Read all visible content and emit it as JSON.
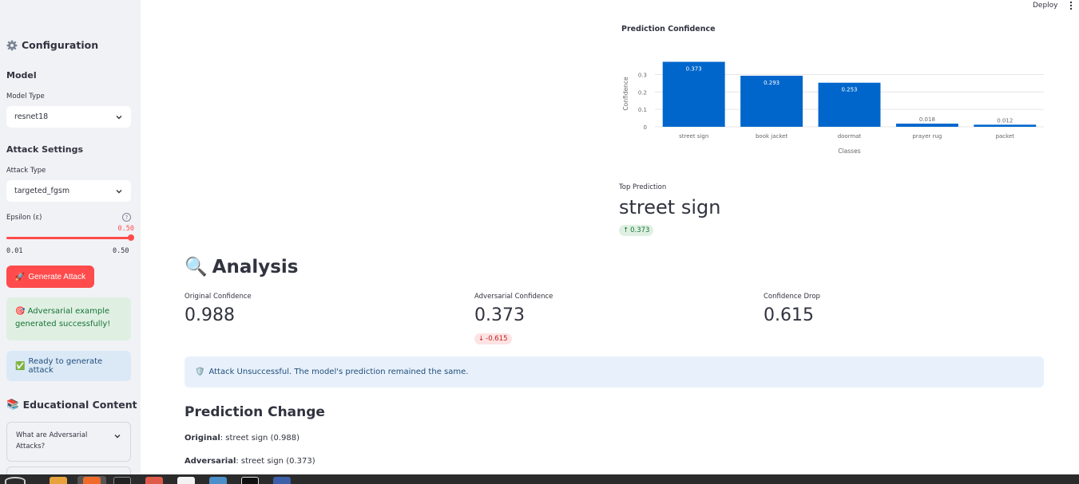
{
  "sidebar": {
    "title": "Configuration",
    "model_heading": "Model",
    "model_type_label": "Model Type",
    "model_type_value": "resnet18",
    "attack_heading": "Attack Settings",
    "attack_type_label": "Attack Type",
    "attack_type_value": "targeted_fgsm",
    "epsilon_label": "Epsilon (ε)",
    "epsilon_value": "0.50",
    "epsilon_min": "0.01",
    "epsilon_max": "0.50",
    "epsilon_fraction": 1.0,
    "generate_button": "Generate Attack",
    "success_message": "Adversarial example generated successfully!",
    "info_message": "Ready to generate attack",
    "edu_title": "Educational Content",
    "expander_label": "What are Adversarial Attacks?"
  },
  "header": {
    "deploy": "Deploy"
  },
  "chart_title": "Prediction Confidence",
  "chart_data": {
    "type": "bar",
    "categories": [
      "street sign",
      "book jacket",
      "doormat",
      "prayer rug",
      "packet"
    ],
    "values": [
      0.373,
      0.293,
      0.253,
      0.018,
      0.012
    ],
    "data_labels": [
      "0.373",
      "0.293",
      "0.253",
      "0.018",
      "0.012"
    ],
    "xlabel": "Classes",
    "ylabel": "Confidence",
    "yticks": [
      "0",
      "0.1",
      "0.2",
      "0.3"
    ],
    "ylim": [
      0,
      0.38
    ],
    "grid": true,
    "color": "#0066cc"
  },
  "top_prediction": {
    "label": "Top Prediction",
    "value": "street sign",
    "delta": "0.373"
  },
  "analysis": {
    "title": "Analysis",
    "original_confidence_label": "Original Confidence",
    "original_confidence_value": "0.988",
    "adversarial_confidence_label": "Adversarial Confidence",
    "adversarial_confidence_value": "0.373",
    "adversarial_delta": "-0.615",
    "drop_label": "Confidence Drop",
    "drop_value": "0.615",
    "banner": "Attack Unsuccessful. The model's prediction remained the same."
  },
  "prediction_change": {
    "title": "Prediction Change",
    "original_label": "Original",
    "original_text": ": street sign (0.988)",
    "adversarial_label": "Adversarial",
    "adversarial_text": ": street sign (0.373)"
  },
  "colors": {
    "accent": "#ff4b4b",
    "bar": "#0066cc",
    "sidebar_bg": "#f0f2f6"
  }
}
